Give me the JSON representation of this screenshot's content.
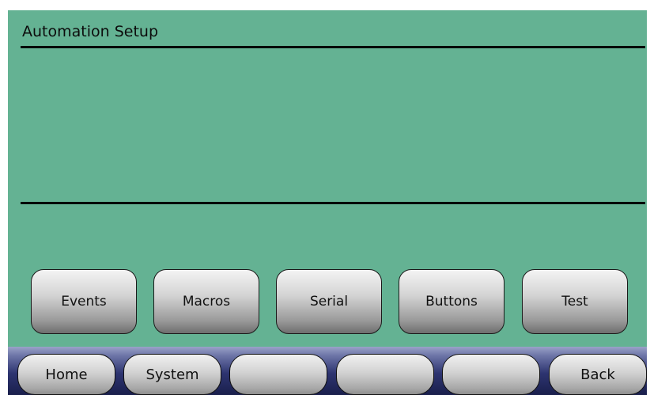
{
  "header": {
    "title": "Automation Setup"
  },
  "functions": {
    "buttons": [
      {
        "label": "Events"
      },
      {
        "label": "Macros"
      },
      {
        "label": "Serial"
      },
      {
        "label": "Buttons"
      },
      {
        "label": "Test"
      }
    ]
  },
  "navbar": {
    "buttons": [
      {
        "label": "Home"
      },
      {
        "label": "System"
      },
      {
        "label": ""
      },
      {
        "label": ""
      },
      {
        "label": ""
      },
      {
        "label": "Back"
      }
    ]
  },
  "colors": {
    "screen_background": "#64b293",
    "navbar_top": "#9aa2c8",
    "navbar_bottom": "#1a1f4c"
  }
}
